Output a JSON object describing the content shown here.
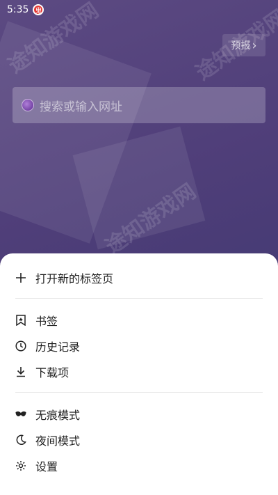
{
  "status_bar": {
    "time": "5:35",
    "badge_glyph": "鬼"
  },
  "watermark": "途知游戏网",
  "header": {
    "forecast_label": "预报",
    "forecast_chevron": "›"
  },
  "search": {
    "placeholder": "搜索或输入网址"
  },
  "menu": {
    "new_tab": "打开新的标签页",
    "bookmarks": "书签",
    "history": "历史记录",
    "downloads": "下载项",
    "incognito": "无痕模式",
    "night_mode": "夜间模式",
    "settings": "设置"
  },
  "colors": {
    "background": "#4f3e79",
    "sheet": "#ffffff",
    "badge": "#e53935"
  }
}
